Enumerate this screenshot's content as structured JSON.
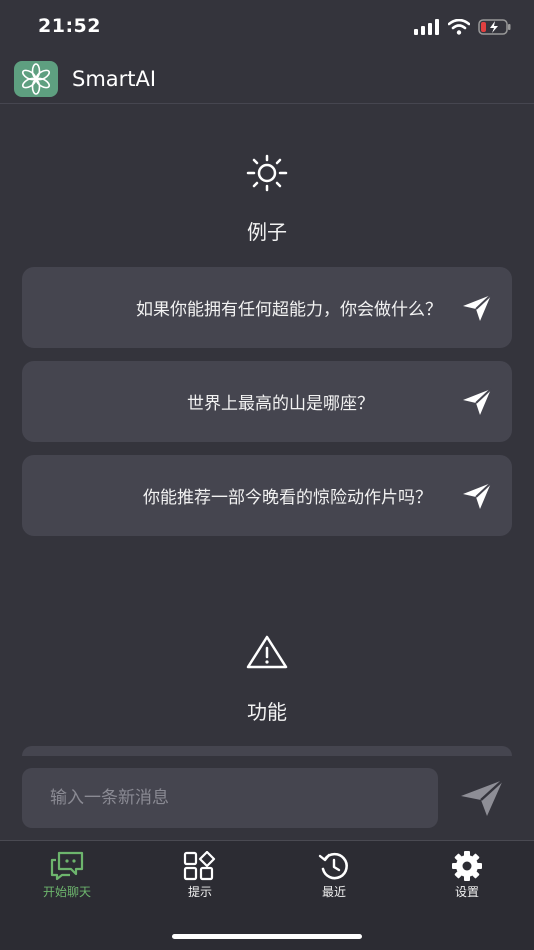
{
  "status_bar": {
    "time": "21:52"
  },
  "header": {
    "app_title": "SmartAI"
  },
  "examples_section": {
    "title": "例子",
    "items": [
      {
        "text": "如果你能拥有任何超能力，你会做什么？"
      },
      {
        "text": "世界上最高的山是哪座？"
      },
      {
        "text": "你能推荐一部今晚看的惊险动作片吗？"
      }
    ]
  },
  "features_section": {
    "title": "功能"
  },
  "composer": {
    "placeholder": "输入一条新消息"
  },
  "tabs": [
    {
      "label": "开始聊天",
      "icon": "chat-icon",
      "active": true
    },
    {
      "label": "提示",
      "icon": "grid-icon",
      "active": false
    },
    {
      "label": "最近",
      "icon": "history-icon",
      "active": false
    },
    {
      "label": "设置",
      "icon": "gear-icon",
      "active": false
    }
  ],
  "colors": {
    "background": "#34343c",
    "card": "#45454f",
    "accent_green": "#6db56d",
    "logo_green": "#5e9f80"
  }
}
